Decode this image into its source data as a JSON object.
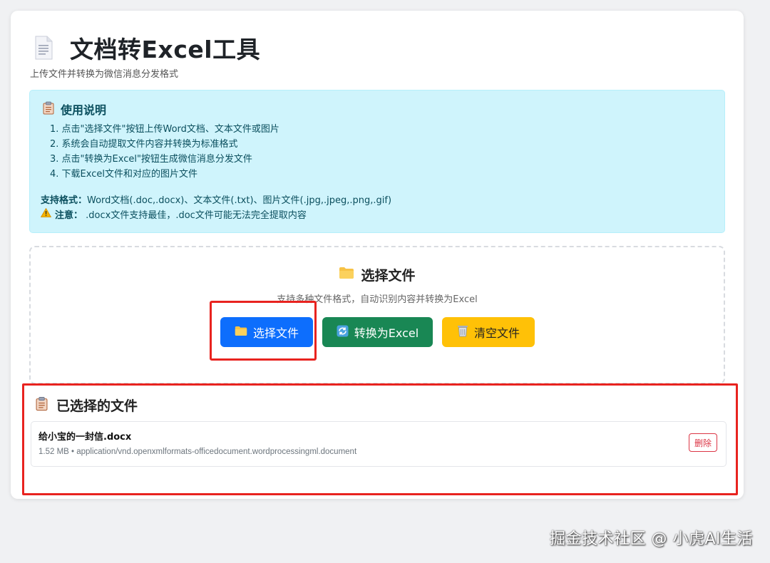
{
  "header": {
    "title": "文档转Excel工具",
    "subtitle": "上传文件并转换为微信消息分发格式",
    "icon": "document-icon"
  },
  "instructions": {
    "heading": "使用说明",
    "steps": [
      "1. 点击\"选择文件\"按钮上传Word文档、文本文件或图片",
      "2. 系统会自动提取文件内容并转换为标准格式",
      "3. 点击\"转换为Excel\"按钮生成微信消息分发文件",
      "4. 下载Excel文件和对应的图片文件"
    ],
    "formats_label": "支持格式：",
    "formats_value": "Word文档(.doc,.docx)、文本文件(.txt)、图片文件(.jpg,.jpeg,.png,.gif)",
    "notice_label": "注意：",
    "notice_value": ".docx文件支持最佳，.doc文件可能无法完全提取内容"
  },
  "upload": {
    "heading": "选择文件",
    "hint": "支持多种文件格式，自动识别内容并转换为Excel",
    "buttons": {
      "select": "选择文件",
      "convert": "转换为Excel",
      "clear": "清空文件"
    }
  },
  "selected": {
    "heading": "已选择的文件",
    "files": [
      {
        "name": "给小宝的一封信.docx",
        "meta": "1.52 MB • application/vnd.openxmlformats-officedocument.wordprocessingml.document",
        "delete_label": "删除"
      }
    ]
  },
  "watermark": "掘金技术社区 @ 小虎AI生活",
  "colors": {
    "primary": "#0d6efd",
    "success": "#198754",
    "warning": "#ffc107",
    "danger": "#dc3545",
    "info_bg": "#cff4fc",
    "highlight": "#e8231f"
  }
}
